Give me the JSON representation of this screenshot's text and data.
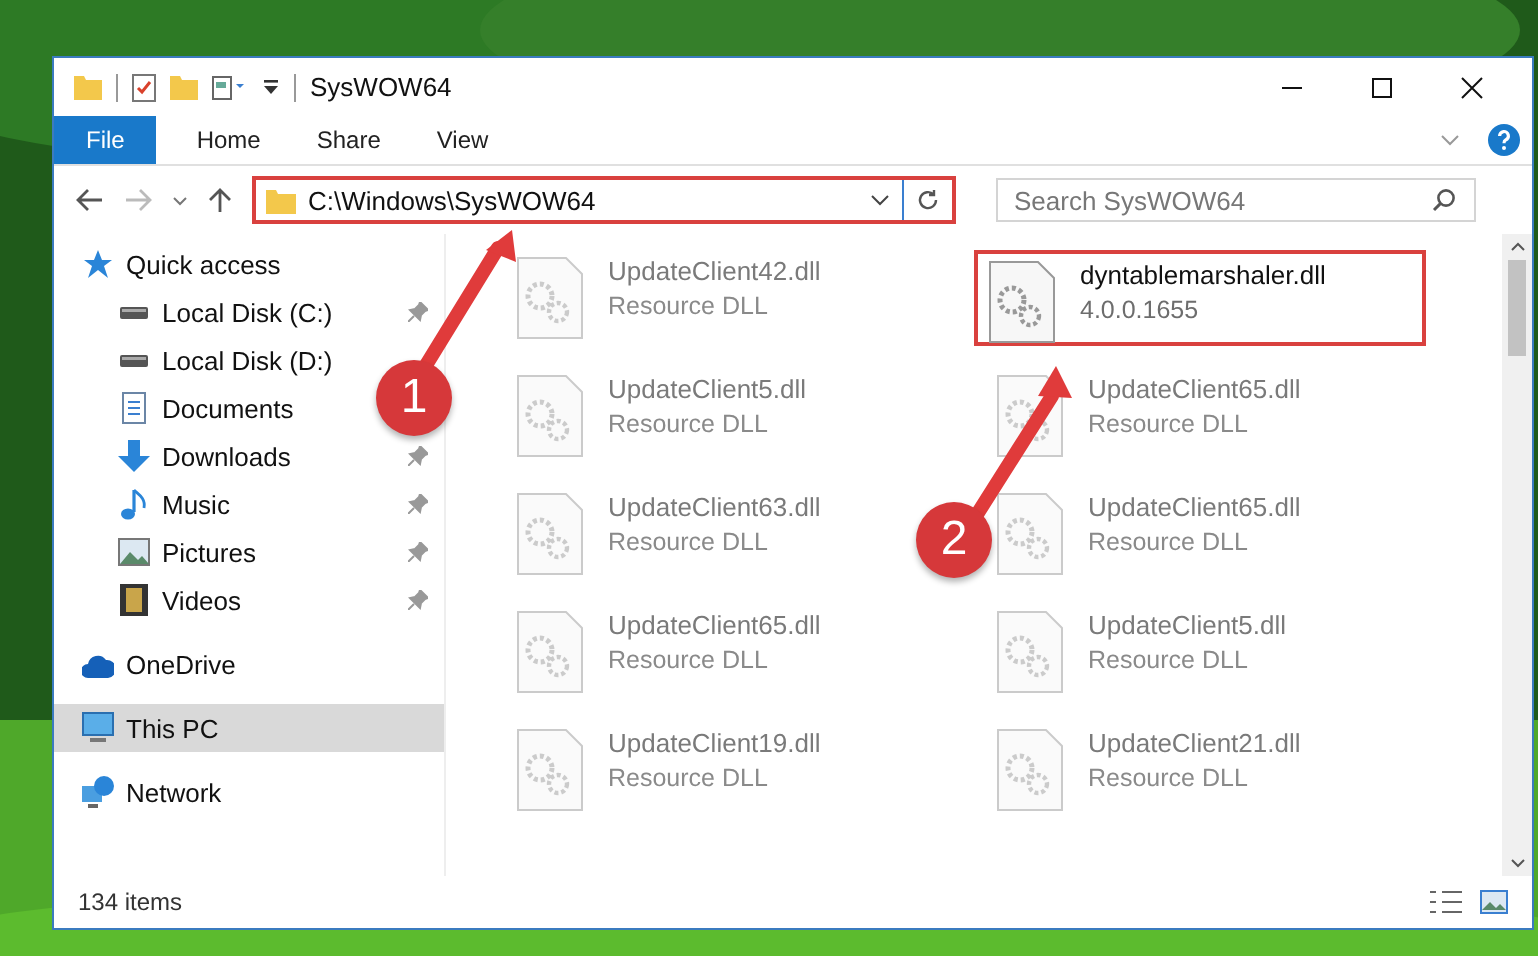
{
  "window": {
    "title": "SysWOW64"
  },
  "ribbon": {
    "tabs": [
      {
        "label": "File",
        "kind": "file",
        "selected": false
      },
      {
        "label": "Home",
        "kind": "tab",
        "selected": false
      },
      {
        "label": "Share",
        "kind": "tab",
        "selected": false
      },
      {
        "label": "View",
        "kind": "tab",
        "selected": false
      }
    ]
  },
  "address_bar": {
    "path": "C:\\Windows\\SysWOW64",
    "highlighted": true
  },
  "search": {
    "placeholder": "Search SysWOW64"
  },
  "sidebar": {
    "items": [
      {
        "label": "Quick access",
        "kind": "star",
        "pinned": false,
        "selected": false,
        "children": [
          {
            "label": "Local Disk (C:)",
            "kind": "disk",
            "pinned": true,
            "selected": false
          },
          {
            "label": "Local Disk (D:)",
            "kind": "disk",
            "pinned": false,
            "selected": false
          },
          {
            "label": "Documents",
            "kind": "doc",
            "pinned": false,
            "selected": false
          },
          {
            "label": "Downloads",
            "kind": "download",
            "pinned": true,
            "selected": false
          },
          {
            "label": "Music",
            "kind": "music",
            "pinned": true,
            "selected": false
          },
          {
            "label": "Pictures",
            "kind": "pictures",
            "pinned": true,
            "selected": false
          },
          {
            "label": "Videos",
            "kind": "videos",
            "pinned": true,
            "selected": false
          }
        ]
      },
      {
        "label": "OneDrive",
        "kind": "cloud",
        "pinned": false,
        "selected": false
      },
      {
        "label": "This PC",
        "kind": "pc",
        "pinned": false,
        "selected": true
      },
      {
        "label": "Network",
        "kind": "network",
        "pinned": false,
        "selected": false
      }
    ]
  },
  "files": [
    {
      "name": "UpdateClient42.dll",
      "detail": "Resource DLL",
      "dimmed": true,
      "highlighted": false
    },
    {
      "name": "dyntablemarshaler.dll",
      "detail": "4.0.0.1655",
      "dimmed": false,
      "highlighted": true
    },
    {
      "name": "UpdateClient5.dll",
      "detail": "Resource DLL",
      "dimmed": true,
      "highlighted": false
    },
    {
      "name": "UpdateClient65.dll",
      "detail": "Resource DLL",
      "dimmed": true,
      "highlighted": false
    },
    {
      "name": "UpdateClient63.dll",
      "detail": "Resource DLL",
      "dimmed": true,
      "highlighted": false
    },
    {
      "name": "UpdateClient65.dll",
      "detail": "Resource DLL",
      "dimmed": true,
      "highlighted": false
    },
    {
      "name": "UpdateClient65.dll",
      "detail": "Resource DLL",
      "dimmed": true,
      "highlighted": false
    },
    {
      "name": "UpdateClient5.dll",
      "detail": "Resource DLL",
      "dimmed": true,
      "highlighted": false
    },
    {
      "name": "UpdateClient19.dll",
      "detail": "Resource DLL",
      "dimmed": true,
      "highlighted": false
    },
    {
      "name": "UpdateClient21.dll",
      "detail": "Resource DLL",
      "dimmed": true,
      "highlighted": false
    }
  ],
  "status_bar": {
    "text": "134 items"
  },
  "annotations": [
    {
      "label": "1"
    },
    {
      "label": "2"
    }
  ]
}
